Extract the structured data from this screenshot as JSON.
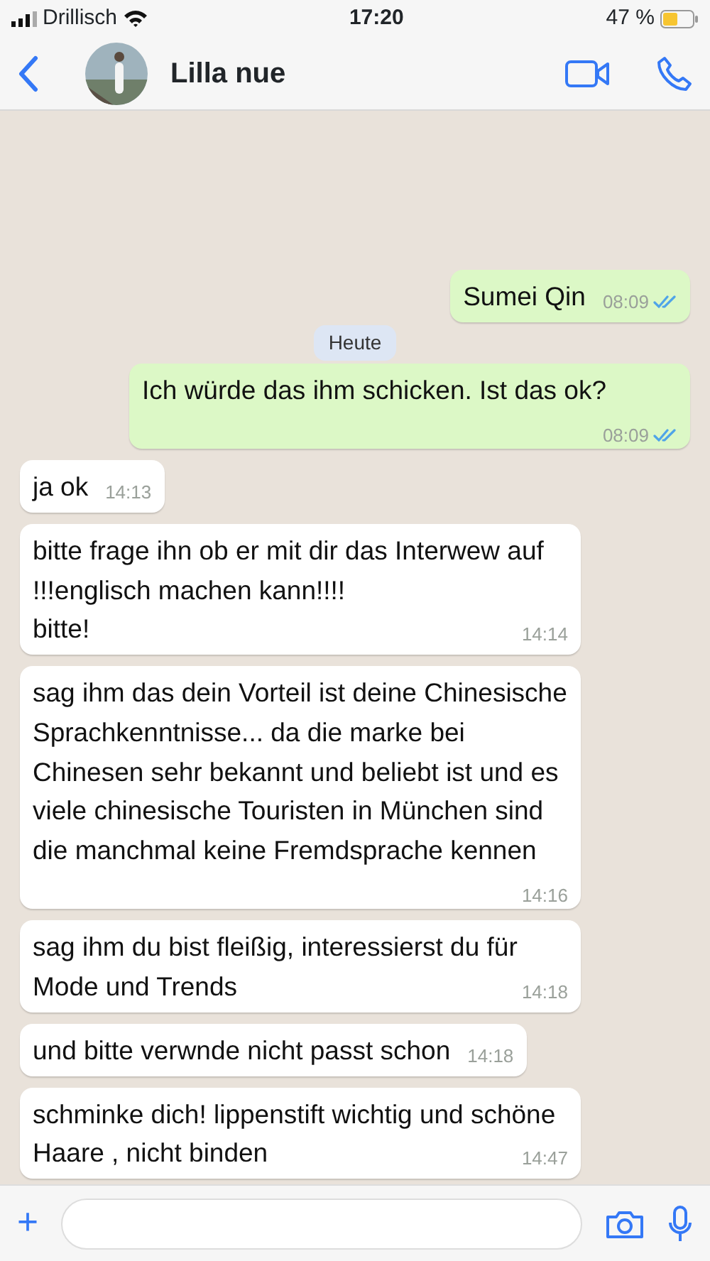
{
  "status_bar": {
    "carrier": "Drillisch",
    "time": "17:20",
    "battery": "47 %"
  },
  "header": {
    "contact": "Lilla nue"
  },
  "date_divider": "Heute",
  "messages": [
    {
      "kind": "out",
      "text": "Sumei Qin",
      "time": "08:09",
      "read": true
    },
    {
      "kind": "divider"
    },
    {
      "kind": "out",
      "text": "Ich würde das ihm schicken. Ist das ok?",
      "time": "08:09",
      "read": true
    },
    {
      "kind": "in",
      "text": "ja ok",
      "time": "14:13"
    },
    {
      "kind": "in",
      "text": "bitte frage ihn ob er mit dir das Interwew auf !!!englisch machen kann!!!!\nbitte!",
      "time": "14:14"
    },
    {
      "kind": "in",
      "text": "sag ihm das dein Vorteil ist deine Chinesische Sprachkenntnisse... da die marke bei Chinesen sehr bekannt und beliebt ist und es viele  chinesische Touristen in München sind die manchmal keine Fremdsprache kennen",
      "time": "14:16"
    },
    {
      "kind": "in",
      "text": "sag ihm du bist fleißig, interessierst du für Mode und Trends",
      "time": "14:18"
    },
    {
      "kind": "in",
      "text": "und bitte verwnde nicht passt schon",
      "time": "14:18"
    },
    {
      "kind": "in",
      "text": "schminke dich! lippenstift wichtig und schöne Haare , nicht binden",
      "time": "14:47"
    }
  ],
  "input": {
    "plus": "+"
  }
}
